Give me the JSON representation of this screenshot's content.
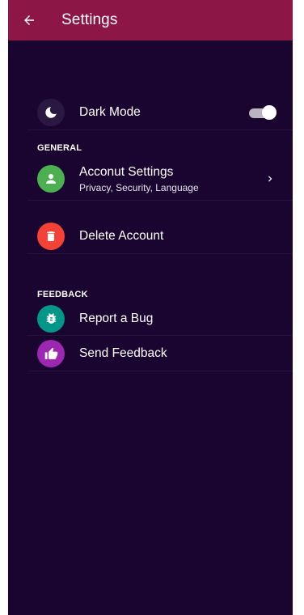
{
  "appbar": {
    "title": "Settings",
    "color": "#8c1646"
  },
  "screen": {
    "background": "#1a0530"
  },
  "dark_mode": {
    "label": "Dark Mode",
    "icon": "moon-icon",
    "enabled": true
  },
  "sections": {
    "general": "GENERAL",
    "feedback": "FEEDBACK"
  },
  "items": {
    "account_settings": {
      "title": "Acconut Settings",
      "subtitle": "Privacy, Security, Language",
      "icon": "person-icon",
      "icon_color": "#4caf50"
    },
    "delete_account": {
      "title": "Delete Account",
      "icon": "trash-icon",
      "icon_color": "#f44336"
    },
    "report_bug": {
      "title": "Report a Bug",
      "icon": "bug-icon",
      "icon_color": "#009688"
    },
    "send_feedback": {
      "title": "Send Feedback",
      "icon": "thumbs-up-icon",
      "icon_color": "#9c27b0"
    }
  }
}
